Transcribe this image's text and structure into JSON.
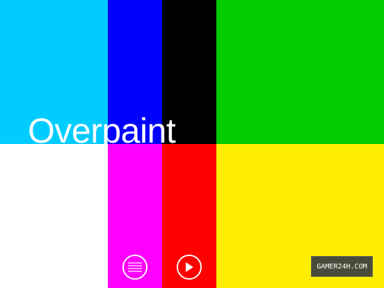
{
  "title": "Overpaint",
  "colors": {
    "cyan": "#00ccff",
    "blue": "#0000ff",
    "black": "#000000",
    "green": "#00cc00",
    "white": "#ffffff",
    "magenta": "#ff00ff",
    "red": "#ff0000",
    "yellow": "#ffee00"
  },
  "buttons": {
    "menu_icon": "hamburger-menu-icon",
    "play_icon": "play-icon"
  },
  "watermark": "GAMER24H.COM"
}
